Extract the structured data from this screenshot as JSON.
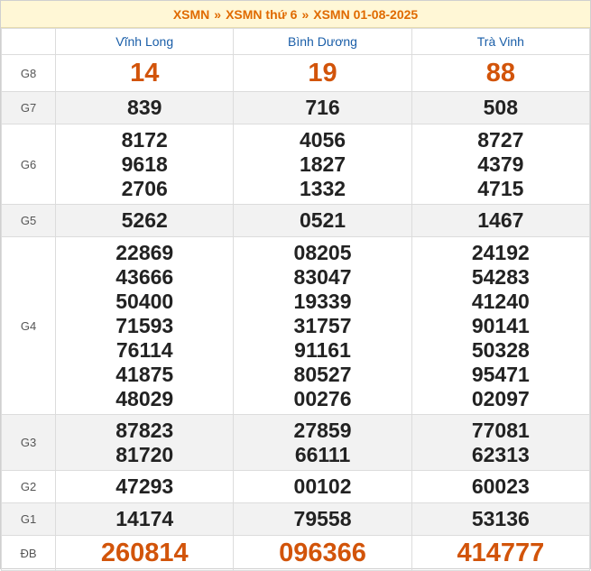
{
  "breadcrumb": {
    "items": [
      "XSMN",
      "XSMN thứ 6",
      "XSMN 01-08-2025"
    ],
    "separator": "»"
  },
  "provinces": [
    "Vĩnh Long",
    "Bình Dương",
    "Trà Vinh"
  ],
  "rows": [
    {
      "label": "G8",
      "values": [
        [
          "14"
        ],
        [
          "19"
        ],
        [
          "88"
        ]
      ]
    },
    {
      "label": "G7",
      "values": [
        [
          "839"
        ],
        [
          "716"
        ],
        [
          "508"
        ]
      ]
    },
    {
      "label": "G6",
      "values": [
        [
          "8172",
          "9618",
          "2706"
        ],
        [
          "4056",
          "1827",
          "1332"
        ],
        [
          "8727",
          "4379",
          "4715"
        ]
      ]
    },
    {
      "label": "G5",
      "values": [
        [
          "5262"
        ],
        [
          "0521"
        ],
        [
          "1467"
        ]
      ]
    },
    {
      "label": "G4",
      "values": [
        [
          "22869",
          "43666",
          "50400",
          "71593",
          "76114",
          "41875",
          "48029"
        ],
        [
          "08205",
          "83047",
          "19339",
          "31757",
          "91161",
          "80527",
          "00276"
        ],
        [
          "24192",
          "54283",
          "41240",
          "90141",
          "50328",
          "95471",
          "02097"
        ]
      ]
    },
    {
      "label": "G3",
      "values": [
        [
          "87823",
          "81720"
        ],
        [
          "27859",
          "66111"
        ],
        [
          "77081",
          "62313"
        ]
      ]
    },
    {
      "label": "G2",
      "values": [
        [
          "47293"
        ],
        [
          "00102"
        ],
        [
          "60023"
        ]
      ]
    },
    {
      "label": "G1",
      "values": [
        [
          "14174"
        ],
        [
          "79558"
        ],
        [
          "53136"
        ]
      ]
    },
    {
      "label": "ĐB",
      "values": [
        [
          "260814"
        ],
        [
          "096366"
        ],
        [
          "414777"
        ]
      ]
    }
  ],
  "colors": {
    "accent": "#e06a00",
    "province": "#1a5ea8",
    "highlight": "#d2540a"
  }
}
